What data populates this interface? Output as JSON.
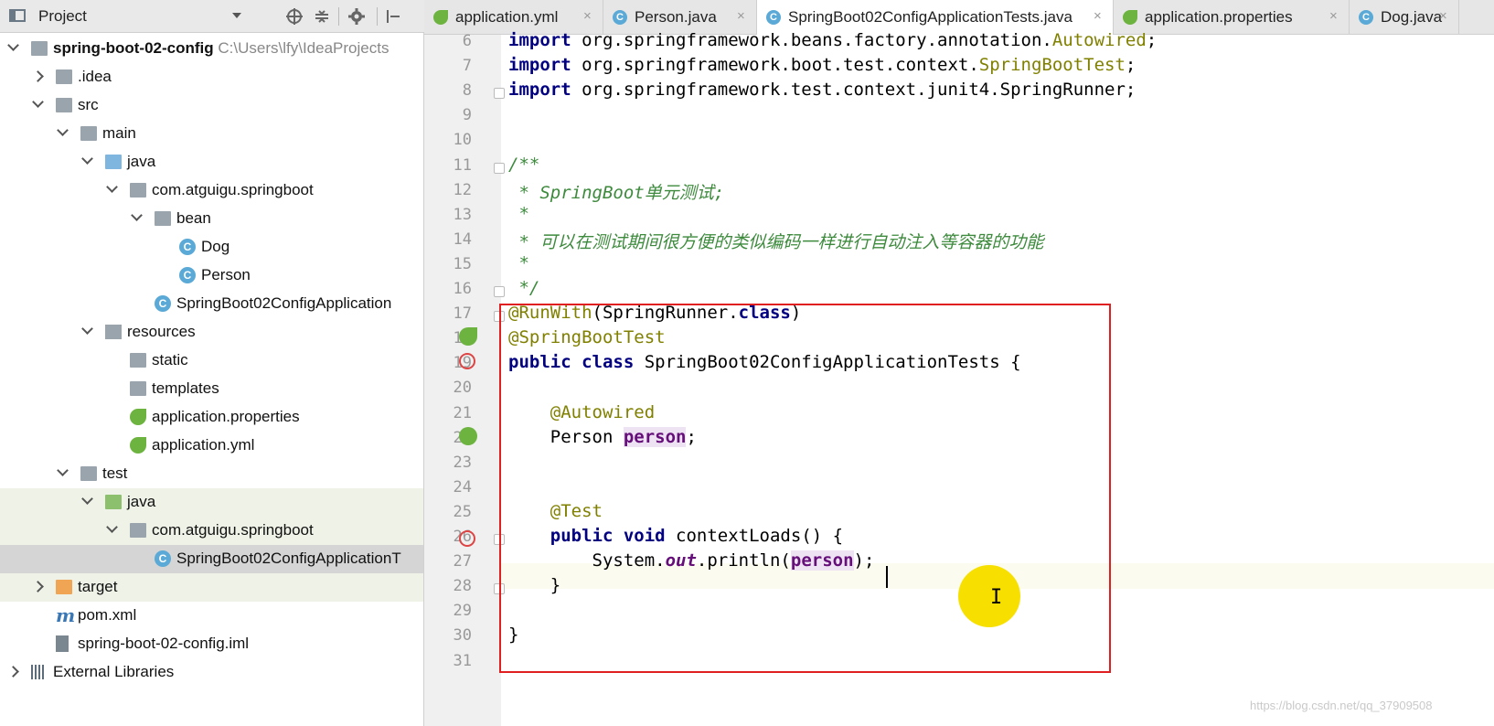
{
  "project_panel": {
    "title": "Project"
  },
  "tree": [
    {
      "label": "spring-boot-02-config",
      "path": "C:\\Users\\lfy\\IdeaProjects",
      "depth": 0,
      "arrow": "down",
      "icon": "module-folder-icon",
      "bold": true
    },
    {
      "label": ".idea",
      "depth": 1,
      "arrow": "right",
      "icon": "folder-icon"
    },
    {
      "label": "src",
      "depth": 1,
      "arrow": "down",
      "icon": "folder-icon"
    },
    {
      "label": "main",
      "depth": 2,
      "arrow": "down",
      "icon": "folder-icon"
    },
    {
      "label": "java",
      "depth": 3,
      "arrow": "down",
      "icon": "source-folder-icon"
    },
    {
      "label": "com.atguigu.springboot",
      "depth": 4,
      "arrow": "down",
      "icon": "package-icon"
    },
    {
      "label": "bean",
      "depth": 5,
      "arrow": "down",
      "icon": "package-icon"
    },
    {
      "label": "Dog",
      "depth": 6,
      "icon": "class-icon"
    },
    {
      "label": "Person",
      "depth": 6,
      "icon": "class-icon"
    },
    {
      "label": "SpringBoot02ConfigApplication",
      "depth": 5,
      "icon": "spring-class-icon"
    },
    {
      "label": "resources",
      "depth": 3,
      "arrow": "down",
      "icon": "resources-folder-icon"
    },
    {
      "label": "static",
      "depth": 4,
      "icon": "folder-icon"
    },
    {
      "label": "templates",
      "depth": 4,
      "icon": "folder-icon"
    },
    {
      "label": "application.properties",
      "depth": 4,
      "icon": "spring-config-icon"
    },
    {
      "label": "application.yml",
      "depth": 4,
      "icon": "spring-config-icon"
    },
    {
      "label": "test",
      "depth": 2,
      "arrow": "down",
      "icon": "folder-icon"
    },
    {
      "label": "java",
      "depth": 3,
      "arrow": "down",
      "icon": "test-folder-icon",
      "highlight": true
    },
    {
      "label": "com.atguigu.springboot",
      "depth": 4,
      "arrow": "down",
      "icon": "package-icon",
      "highlight": true
    },
    {
      "label": "SpringBoot02ConfigApplicationT",
      "depth": 5,
      "icon": "spring-class-icon",
      "selected": true
    },
    {
      "label": "target",
      "depth": 1,
      "arrow": "right",
      "icon": "excluded-folder-icon",
      "highlight": true
    },
    {
      "label": "pom.xml",
      "depth": 1,
      "icon": "maven-icon"
    },
    {
      "label": "spring-boot-02-config.iml",
      "depth": 1,
      "icon": "iml-file-icon"
    },
    {
      "label": "External Libraries",
      "depth": 0,
      "arrow": "right",
      "icon": "libraries-icon"
    }
  ],
  "tabs": [
    {
      "label": "application.yml",
      "icon": "spring-config-icon",
      "active": false
    },
    {
      "label": "Person.java",
      "icon": "class-icon",
      "active": false
    },
    {
      "label": "SpringBoot02ConfigApplicationTests.java",
      "icon": "spring-class-icon",
      "active": true
    },
    {
      "label": "application.properties",
      "icon": "spring-config-icon",
      "active": false
    },
    {
      "label": "Dog.java",
      "icon": "class-icon",
      "active": false
    }
  ],
  "editor": {
    "line_numbers": [
      "6",
      "7",
      "8",
      "9",
      "10",
      "11",
      "12",
      "13",
      "14",
      "15",
      "16",
      "17",
      "18",
      "19",
      "20",
      "21",
      "22",
      "23",
      "24",
      "25",
      "26",
      "27",
      "28",
      "29",
      "30",
      "31"
    ],
    "lines": [
      [
        {
          "t": "import ",
          "c": "kw"
        },
        {
          "t": "org.springframework.beans.factory.annotation."
        },
        {
          "t": "Autowired",
          "c": "ann"
        },
        {
          "t": ";"
        }
      ],
      [
        {
          "t": "import ",
          "c": "kw"
        },
        {
          "t": "org.springframework.boot.test.context."
        },
        {
          "t": "SpringBootTest",
          "c": "ann"
        },
        {
          "t": ";"
        }
      ],
      [
        {
          "t": "import ",
          "c": "kw"
        },
        {
          "t": "org.springframework.test.context.junit4.SpringRunner;"
        }
      ],
      [],
      [],
      [
        {
          "t": "/**",
          "c": "cm-doc"
        }
      ],
      [
        {
          "t": " * ",
          "c": "cm-doc"
        },
        {
          "t": "SpringBoot单元测试;",
          "c": "cm-doc"
        }
      ],
      [
        {
          "t": " *",
          "c": "cm-doc"
        }
      ],
      [
        {
          "t": " * 可以在测试期间很方便的类似编码一样进行自动注入等容器的功能",
          "c": "cm-doc"
        }
      ],
      [
        {
          "t": " *",
          "c": "cm-doc"
        }
      ],
      [
        {
          "t": " */",
          "c": "cm-doc"
        }
      ],
      [
        {
          "t": "@RunWith",
          "c": "ann"
        },
        {
          "t": "(SpringRunner."
        },
        {
          "t": "class",
          "c": "kw"
        },
        {
          "t": ")"
        }
      ],
      [
        {
          "t": "@SpringBootTest",
          "c": "ann"
        }
      ],
      [
        {
          "t": "public class ",
          "c": "kw"
        },
        {
          "t": "SpringBoot02ConfigApplicationTests {"
        }
      ],
      [],
      [
        {
          "t": "    "
        },
        {
          "t": "@Autowired",
          "c": "ann"
        }
      ],
      [
        {
          "t": "    Person "
        },
        {
          "t": "person",
          "c": "fld"
        },
        {
          "t": ";"
        }
      ],
      [],
      [],
      [
        {
          "t": "    "
        },
        {
          "t": "@Test",
          "c": "ann"
        }
      ],
      [
        {
          "t": "    "
        },
        {
          "t": "public void ",
          "c": "kw"
        },
        {
          "t": "contextLoads() {"
        }
      ],
      [
        {
          "t": "        System."
        },
        {
          "t": "out",
          "c": "fld-it"
        },
        {
          "t": ".println("
        },
        {
          "t": "person",
          "c": "fld"
        },
        {
          "t": ");"
        }
      ],
      [
        {
          "t": "    }"
        }
      ],
      [],
      [
        {
          "t": "}"
        }
      ],
      []
    ]
  },
  "watermark": "https://blog.csdn.net/qq_37909508",
  "cursor_glyph": "I"
}
